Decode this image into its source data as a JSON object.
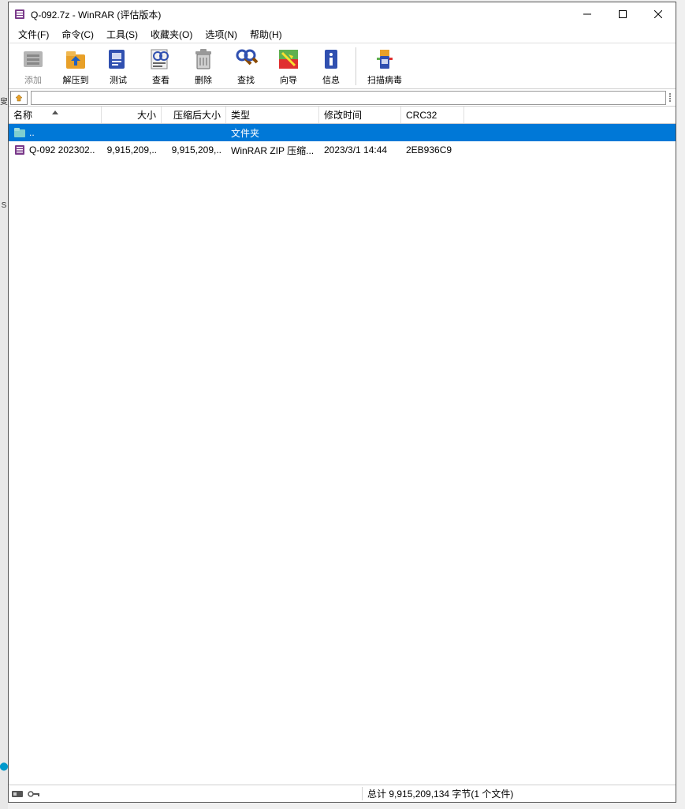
{
  "titlebar": {
    "title": "Q-092.7z - WinRAR (评估版本)"
  },
  "menu": [
    "文件(F)",
    "命令(C)",
    "工具(S)",
    "收藏夹(O)",
    "选项(N)",
    "帮助(H)"
  ],
  "toolbar": {
    "add": "添加",
    "extract": "解压到",
    "test": "测试",
    "view": "查看",
    "delete": "删除",
    "find": "查找",
    "wizard": "向导",
    "info": "信息",
    "virus": "扫描病毒"
  },
  "columns": {
    "name": "名称",
    "size": "大小",
    "packed": "压缩后大小",
    "type": "类型",
    "modified": "修改时间",
    "crc": "CRC32"
  },
  "rows": [
    {
      "name": "..",
      "size": "",
      "packed": "",
      "type": "文件夹",
      "modified": "",
      "crc": "",
      "selected": true,
      "icon": "folder"
    },
    {
      "name": "Q-092  202302..",
      "size": "9,915,209,..",
      "packed": "9,915,209,..",
      "type": "WinRAR ZIP 压缩...",
      "modified": "2023/3/1 14:44",
      "crc": "2EB936C9",
      "selected": false,
      "icon": "archive"
    }
  ],
  "status": {
    "right": "总计 9,915,209,134 字节(1 个文件)"
  },
  "bg_hints": [
    "叟",
    "S",
    "叟"
  ]
}
